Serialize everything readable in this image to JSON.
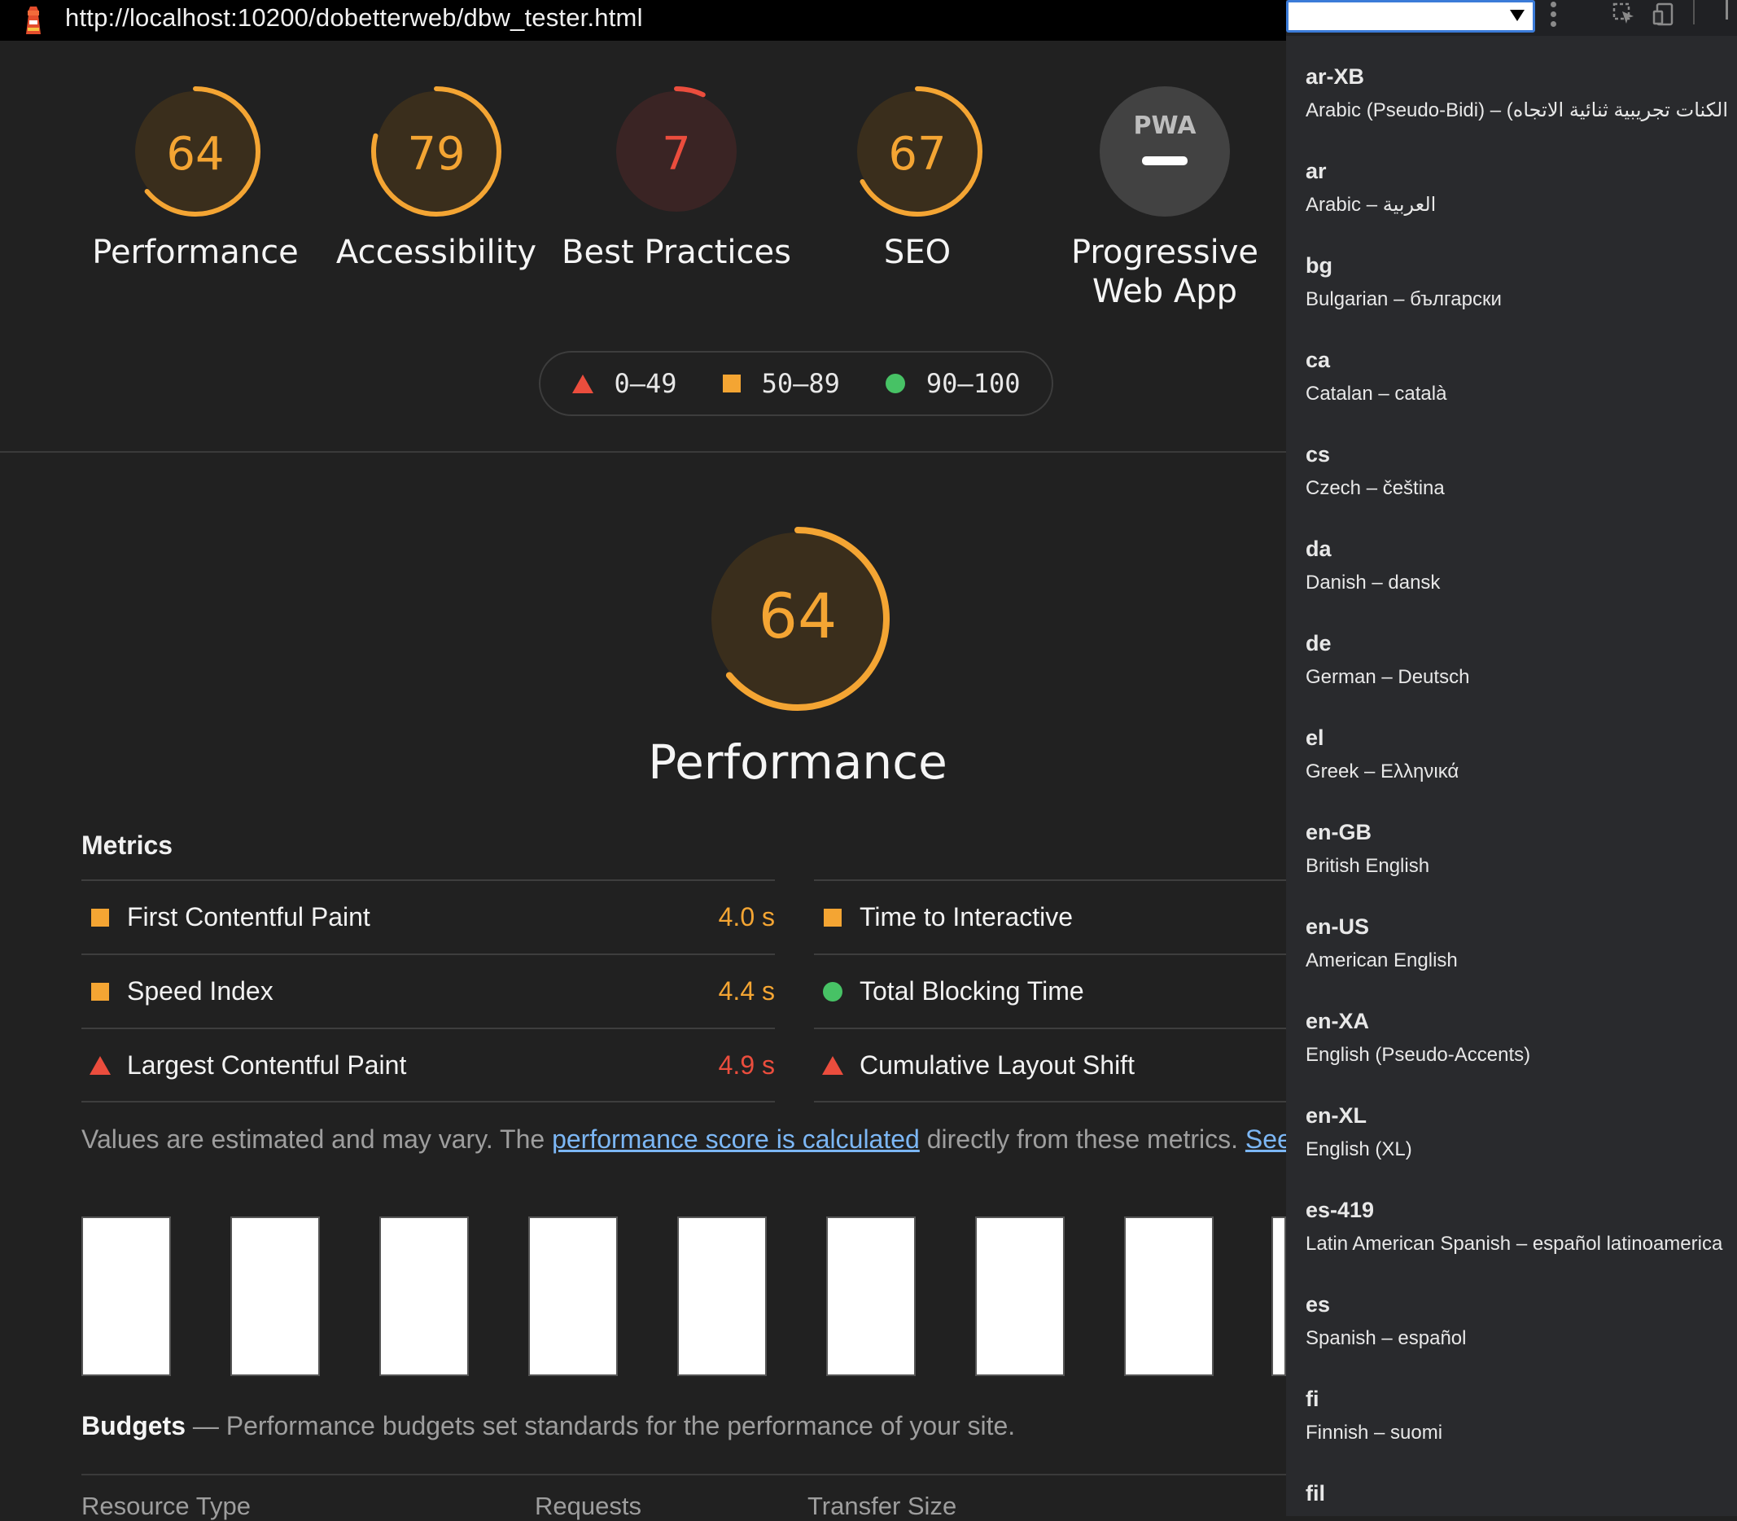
{
  "browser": {
    "url": "http://localhost:10200/dobetterweb/dbw_tester.html",
    "logo_icon": "lighthouse-icon"
  },
  "colors": {
    "fail": "#eb4d3d",
    "average": "#f4a533",
    "pass": "#47c265",
    "background": "#212121",
    "panel": "#292a2d"
  },
  "gauges": [
    {
      "score": "64",
      "label": "Performance",
      "value": 64,
      "color": "#f4a533",
      "fill": "#3a2e1c"
    },
    {
      "score": "79",
      "label": "Accessibility",
      "value": 79,
      "color": "#f4a533",
      "fill": "#3a2e1c"
    },
    {
      "score": "7",
      "label": "Best Practices",
      "value": 7,
      "color": "#eb4d3d",
      "fill": "#3a2424"
    },
    {
      "score": "67",
      "label": "SEO",
      "value": 67,
      "color": "#f4a533",
      "fill": "#3a2e1c"
    }
  ],
  "pwa": {
    "badge": "PWA",
    "label_line1": "Progressive",
    "label_line2": "Web App",
    "icon": "pwa-badge-icon"
  },
  "legend": [
    {
      "range": "0–49",
      "icon": "triangle-icon"
    },
    {
      "range": "50–89",
      "icon": "square-icon"
    },
    {
      "range": "90–100",
      "icon": "circle-icon"
    }
  ],
  "performance": {
    "score": "64",
    "value": 64,
    "title": "Performance",
    "metrics_heading": "Metrics",
    "metrics_left": [
      {
        "name": "First Contentful Paint",
        "value": "4.0 s",
        "rating": "average"
      },
      {
        "name": "Speed Index",
        "value": "4.4 s",
        "rating": "average"
      },
      {
        "name": "Largest Contentful Paint",
        "value": "4.9 s",
        "rating": "fail"
      }
    ],
    "metrics_right": [
      {
        "name": "Time to Interactive",
        "rating": "average"
      },
      {
        "name": "Total Blocking Time",
        "rating": "pass"
      },
      {
        "name": "Cumulative Layout Shift",
        "rating": "fail"
      }
    ],
    "note_prefix": "Values are estimated and may vary. The ",
    "note_link": "performance score is calculated",
    "note_suffix": " directly from these metrics. ",
    "note_link2": "See"
  },
  "budgets": {
    "title": "Budgets",
    "description": " — Performance budgets set standards for the performance of your site.",
    "columns": [
      "Resource Type",
      "Requests",
      "Transfer Size"
    ]
  },
  "locales": [
    {
      "code": "ar-XB",
      "name": "Arabic (Pseudo-Bidi) – (الكنات تجريبية ثنائية الاتجاه"
    },
    {
      "code": "ar",
      "name": "Arabic – العربية"
    },
    {
      "code": "bg",
      "name": "Bulgarian – български"
    },
    {
      "code": "ca",
      "name": "Catalan – català"
    },
    {
      "code": "cs",
      "name": "Czech – čeština"
    },
    {
      "code": "da",
      "name": "Danish – dansk"
    },
    {
      "code": "de",
      "name": "German – Deutsch"
    },
    {
      "code": "el",
      "name": "Greek – Ελληνικά"
    },
    {
      "code": "en-GB",
      "name": "British English"
    },
    {
      "code": "en-US",
      "name": "American English"
    },
    {
      "code": "en-XA",
      "name": "English (Pseudo-Accents)"
    },
    {
      "code": "en-XL",
      "name": "English (XL)"
    },
    {
      "code": "es-419",
      "name": "Latin American Spanish – español latinoamerica"
    },
    {
      "code": "es",
      "name": "Spanish – español"
    },
    {
      "code": "fi",
      "name": "Finnish – suomi"
    },
    {
      "code": "fil",
      "name": ""
    }
  ]
}
